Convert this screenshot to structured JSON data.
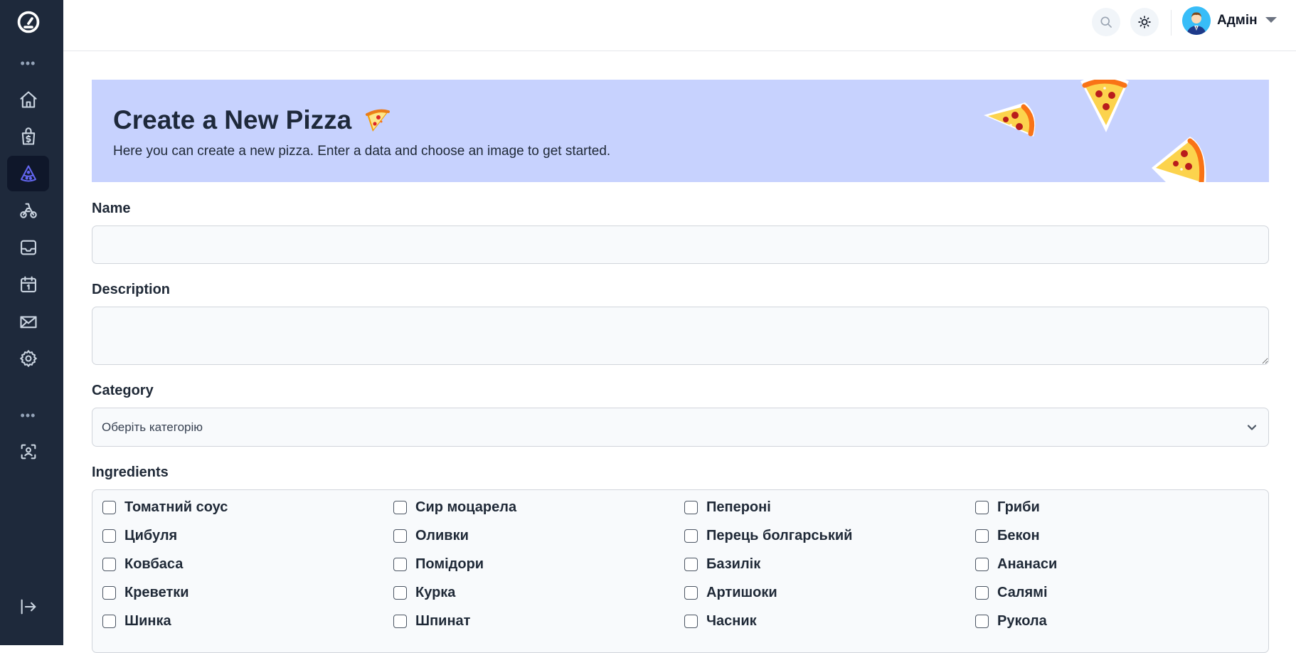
{
  "sidebar": {
    "items": [
      {
        "name": "dashboard-logo-icon"
      },
      {
        "name": "home-icon"
      },
      {
        "name": "shopping-bag-icon"
      },
      {
        "name": "pizza-icon"
      },
      {
        "name": "scooter-icon"
      },
      {
        "name": "inbox-icon"
      },
      {
        "name": "calendar-icon"
      },
      {
        "name": "mail-icon"
      },
      {
        "name": "settings-icon"
      },
      {
        "name": "user-scan-icon"
      },
      {
        "name": "logout-icon"
      }
    ],
    "active_item": "pizza-icon"
  },
  "header": {
    "user_name": "Адмін",
    "search_icon": "search-icon",
    "theme_icon": "sun-icon"
  },
  "banner": {
    "title": "Create a New Pizza",
    "title_emoji": "🍕",
    "subtitle": "Here you can create a new pizza. Enter a data and choose an image to get started.",
    "background": "#c7d2fe"
  },
  "form": {
    "name_label": "Name",
    "name_value": "",
    "description_label": "Description",
    "description_value": "",
    "category_label": "Category",
    "category_selected": "Оберіть категорію",
    "ingredients_label": "Ingredients",
    "ingredients": [
      [
        "Томатний соус",
        "Сир моцарела",
        "Пепероні",
        "Гриби"
      ],
      [
        "Цибуля",
        "Оливки",
        "Перець болгарський",
        "Бекон"
      ],
      [
        "Ковбаса",
        "Помідори",
        "Базилік",
        "Ананаси"
      ],
      [
        "Креветки",
        "Курка",
        "Артишоки",
        "Салямі"
      ],
      [
        "Шинка",
        "Шпинат",
        "Часник",
        "Рукола"
      ]
    ]
  },
  "colors": {
    "sidebar_bg": "#1e293b",
    "accent": "#6366f1",
    "banner_bg": "#c7d2fe"
  }
}
